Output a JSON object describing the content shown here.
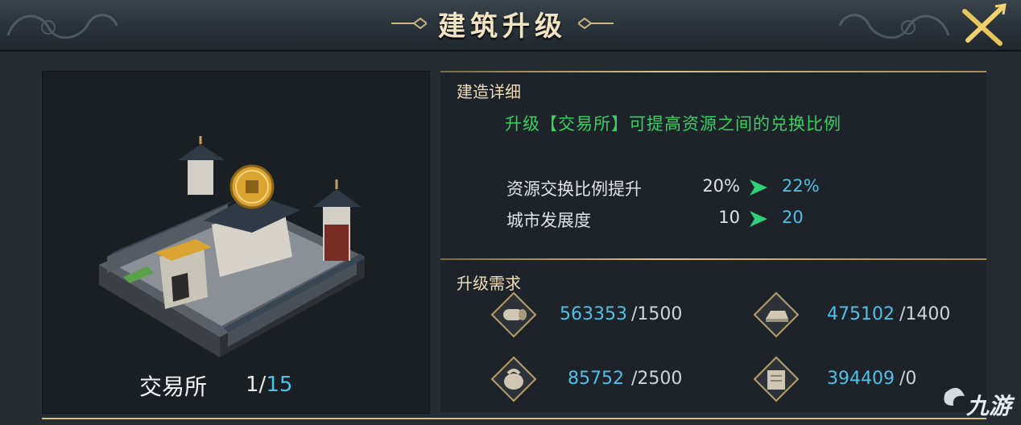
{
  "header": {
    "title": "建筑升级",
    "close_icon": "close-x-icon",
    "colors": {
      "title": "#f1e4c2",
      "accent_gold": "#d8c08a"
    }
  },
  "building": {
    "name": "交易所",
    "level_current": "1",
    "level_separator": "/",
    "level_max": "15",
    "image": "trading-post-building-image"
  },
  "details": {
    "section_title": "建造详细",
    "description": "升级【交易所】可提高资源之间的兑换比例",
    "stats": [
      {
        "label": "资源交换比例提升",
        "from": "20%",
        "to": "22%"
      },
      {
        "label": "城市发展度",
        "from": "10",
        "to": "20"
      }
    ],
    "colors": {
      "description": "#37d063",
      "upgrade_value": "#4fc1e6",
      "arrow": "#2fd07a"
    }
  },
  "requirements": {
    "section_title": "升级需求",
    "items": [
      {
        "icon": "wood-log-icon",
        "have": "563353",
        "need": "/1500"
      },
      {
        "icon": "iron-ingot-icon",
        "have": "475102",
        "need": "/1400"
      },
      {
        "icon": "grain-sack-icon",
        "have": "85752",
        "need": "/2500"
      },
      {
        "icon": "scroll-icon",
        "have": "394409",
        "need": "/0"
      }
    ]
  },
  "watermark": {
    "text": "九游"
  }
}
